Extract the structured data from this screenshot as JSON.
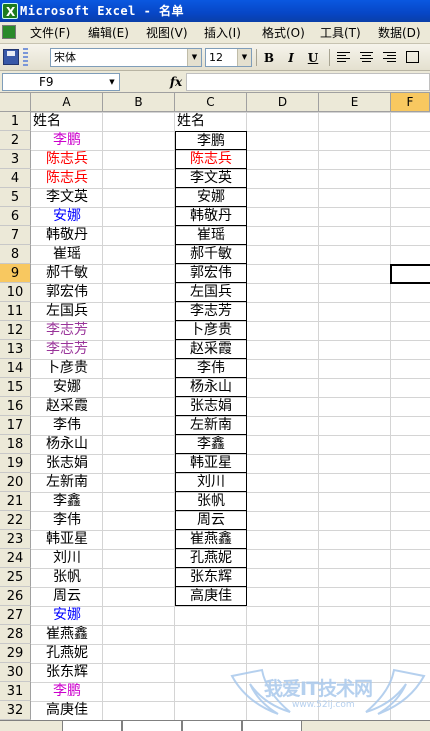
{
  "window": {
    "title": "Microsoft Excel - 名单"
  },
  "menu": [
    "文件(F)",
    "编辑(E)",
    "视图(V)",
    "插入(I)",
    "格式(O)",
    "工具(T)",
    "数据(D)"
  ],
  "toolbar": {
    "font_name": "宋体",
    "font_size": "12",
    "bold": "B",
    "italic": "I",
    "underline": "U"
  },
  "formula_bar": {
    "name_box": "F9",
    "fx": "fx",
    "formula": ""
  },
  "columns": [
    "A",
    "B",
    "C",
    "D",
    "E",
    "F"
  ],
  "active_column": "F",
  "active_row": "9",
  "rows": [
    "1",
    "2",
    "3",
    "4",
    "5",
    "6",
    "7",
    "8",
    "9",
    "10",
    "11",
    "12",
    "13",
    "14",
    "15",
    "16",
    "17",
    "18",
    "19",
    "20",
    "21",
    "22",
    "23",
    "24",
    "25",
    "26",
    "27",
    "28",
    "29",
    "30",
    "31",
    "32"
  ],
  "column_a": [
    {
      "text": "姓名",
      "color": "#000000"
    },
    {
      "text": "李鹏",
      "color": "#cc00cc"
    },
    {
      "text": "陈志兵",
      "color": "#ff0000"
    },
    {
      "text": "陈志兵",
      "color": "#ff0000"
    },
    {
      "text": "李文英",
      "color": "#000000"
    },
    {
      "text": "安娜",
      "color": "#0000ff"
    },
    {
      "text": "韩敬丹",
      "color": "#000000"
    },
    {
      "text": "崔瑶",
      "color": "#000000"
    },
    {
      "text": "郝千敏",
      "color": "#000000"
    },
    {
      "text": "郭宏伟",
      "color": "#000000"
    },
    {
      "text": "左国兵",
      "color": "#000000"
    },
    {
      "text": "李志芳",
      "color": "#993399"
    },
    {
      "text": "李志芳",
      "color": "#993399"
    },
    {
      "text": "卜彦贵",
      "color": "#000000"
    },
    {
      "text": "安娜",
      "color": "#000000"
    },
    {
      "text": "赵采霞",
      "color": "#000000"
    },
    {
      "text": "李伟",
      "color": "#000000"
    },
    {
      "text": "杨永山",
      "color": "#000000"
    },
    {
      "text": "张志娟",
      "color": "#000000"
    },
    {
      "text": "左新南",
      "color": "#000000"
    },
    {
      "text": "李鑫",
      "color": "#000000"
    },
    {
      "text": "李伟",
      "color": "#000000"
    },
    {
      "text": "韩亚星",
      "color": "#000000"
    },
    {
      "text": "刘川",
      "color": "#000000"
    },
    {
      "text": "张帆",
      "color": "#000000"
    },
    {
      "text": "周云",
      "color": "#000000"
    },
    {
      "text": "安娜",
      "color": "#0000ff"
    },
    {
      "text": "崔燕鑫",
      "color": "#000000"
    },
    {
      "text": "孔燕妮",
      "color": "#000000"
    },
    {
      "text": "张东辉",
      "color": "#000000"
    },
    {
      "text": "李鹏",
      "color": "#cc00cc"
    },
    {
      "text": "高庚佳",
      "color": "#000000"
    }
  ],
  "column_c": [
    {
      "text": "姓名",
      "color": "#000000"
    },
    {
      "text": "李鹏",
      "color": "#000000"
    },
    {
      "text": "陈志兵",
      "color": "#ff0000"
    },
    {
      "text": "李文英",
      "color": "#000000"
    },
    {
      "text": "安娜",
      "color": "#000000"
    },
    {
      "text": "韩敬丹",
      "color": "#000000"
    },
    {
      "text": "崔瑶",
      "color": "#000000"
    },
    {
      "text": "郝千敏",
      "color": "#000000"
    },
    {
      "text": "郭宏伟",
      "color": "#000000"
    },
    {
      "text": "左国兵",
      "color": "#000000"
    },
    {
      "text": "李志芳",
      "color": "#000000"
    },
    {
      "text": "卜彦贵",
      "color": "#000000"
    },
    {
      "text": "赵采霞",
      "color": "#000000"
    },
    {
      "text": "李伟",
      "color": "#000000"
    },
    {
      "text": "杨永山",
      "color": "#000000"
    },
    {
      "text": "张志娟",
      "color": "#000000"
    },
    {
      "text": "左新南",
      "color": "#000000"
    },
    {
      "text": "李鑫",
      "color": "#000000"
    },
    {
      "text": "韩亚星",
      "color": "#000000"
    },
    {
      "text": "刘川",
      "color": "#000000"
    },
    {
      "text": "张帆",
      "color": "#000000"
    },
    {
      "text": "周云",
      "color": "#000000"
    },
    {
      "text": "崔燕鑫",
      "color": "#000000"
    },
    {
      "text": "孔燕妮",
      "color": "#000000"
    },
    {
      "text": "张东辉",
      "color": "#000000"
    },
    {
      "text": "高庚佳",
      "color": "#000000"
    }
  ],
  "watermark": {
    "text": "我爱IT技术网",
    "url": "www.52ij.com"
  }
}
